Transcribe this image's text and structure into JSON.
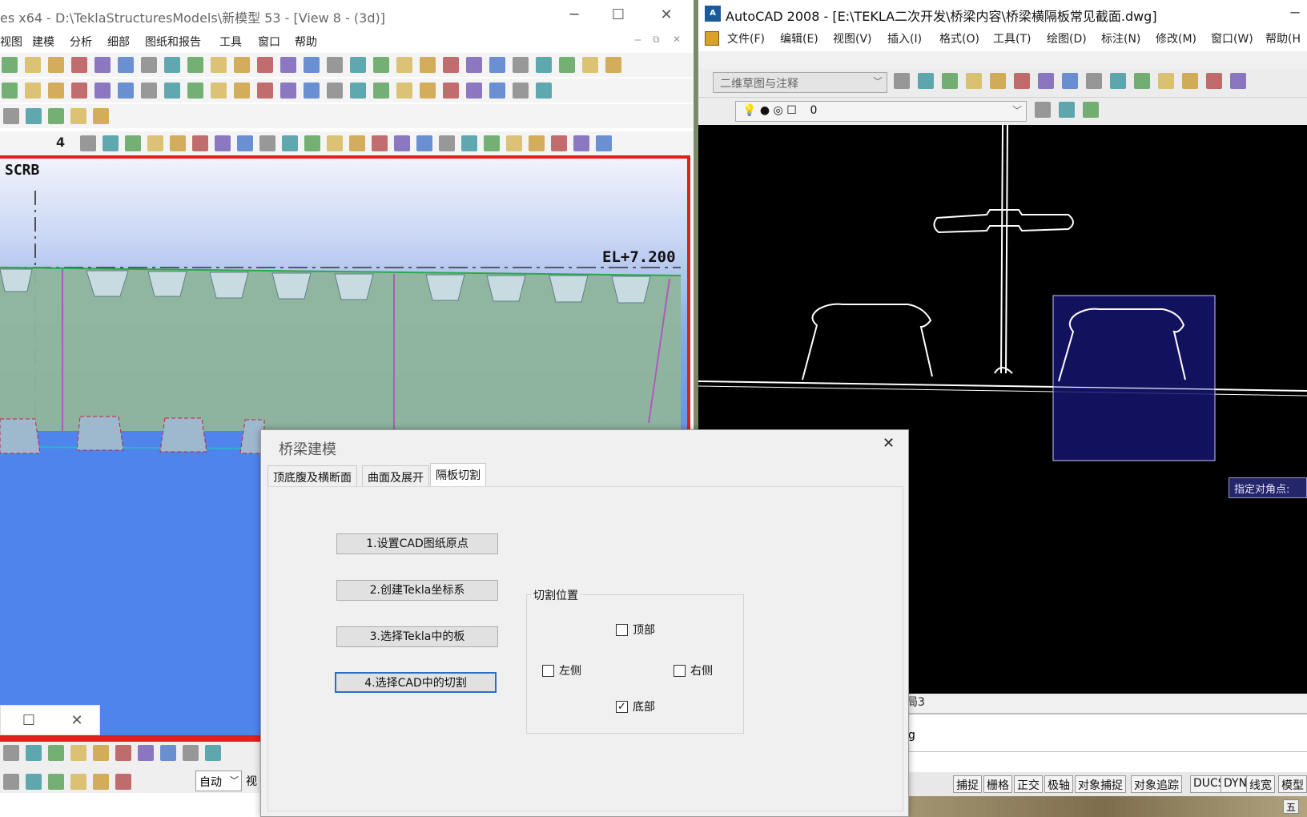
{
  "tekla": {
    "title": "es x64 - D:\\TeklaStructuresModels\\新模型 53  - [View 8 - (3d)]",
    "window_buttons": {
      "minimize": "─",
      "maximize": "☐",
      "close": "✕"
    },
    "menu": [
      "视图",
      "建模",
      "分析",
      "细部",
      "图纸和报告",
      "工具",
      "窗口",
      "帮助"
    ],
    "mdi_buttons": {
      "minimize": "‒",
      "restore": "⧉",
      "close": "✕"
    },
    "view_labels": {
      "grid": "SCRB",
      "elevation": "EL+7.200"
    },
    "small_panel": {
      "maximize": "☐",
      "close": "✕"
    },
    "bottom_combo": {
      "value": "自动",
      "extra": "视"
    }
  },
  "acad": {
    "title": "AutoCAD 2008 - [E:\\TEKLA二次开发\\桥梁内容\\桥梁横隔板常见截面.dwg]",
    "logo": "A",
    "window_minimize": "─",
    "menu": [
      "文件(F)",
      "编辑(E)",
      "视图(V)",
      "插入(I)",
      "格式(O)",
      "工具(T)",
      "绘图(D)",
      "标注(N)",
      "修改(M)",
      "窗口(W)",
      "帮助(H"
    ],
    "workspace_combo": "二维草图与注释",
    "layer_combo": "0",
    "tooltip": "指定对角点:",
    "layout_tab": "局3",
    "command_text": "g",
    "status_buttons": [
      "捕捉",
      "栅格",
      "正交",
      "极轴",
      "对象捕捉",
      "对象追踪",
      "DUCS",
      "DYN",
      "线宽",
      "模型"
    ],
    "tray_char": "五"
  },
  "dialog": {
    "title": "桥梁建模",
    "close": "✕",
    "tabs": [
      "顶底腹及横断面",
      "曲面及展开",
      "隔板切割"
    ],
    "active_tab": "隔板切割",
    "steps": [
      "1.设置CAD图纸原点",
      "2.创建Tekla坐标系",
      "3.选择Tekla中的板",
      "4.选择CAD中的切割"
    ],
    "group_label": "切割位置",
    "checks": {
      "top": {
        "label": "顶部",
        "checked": false
      },
      "left": {
        "label": "左侧",
        "checked": false
      },
      "right": {
        "label": "右侧",
        "checked": false
      },
      "bottom": {
        "label": "底部",
        "checked": true
      }
    },
    "check_mark": "✓"
  },
  "colors": {
    "tekla_frame": "#e0201b",
    "acad_canvas": "#000000",
    "selection_fill": "#14146e",
    "focus_blue": "#2a70c9"
  }
}
